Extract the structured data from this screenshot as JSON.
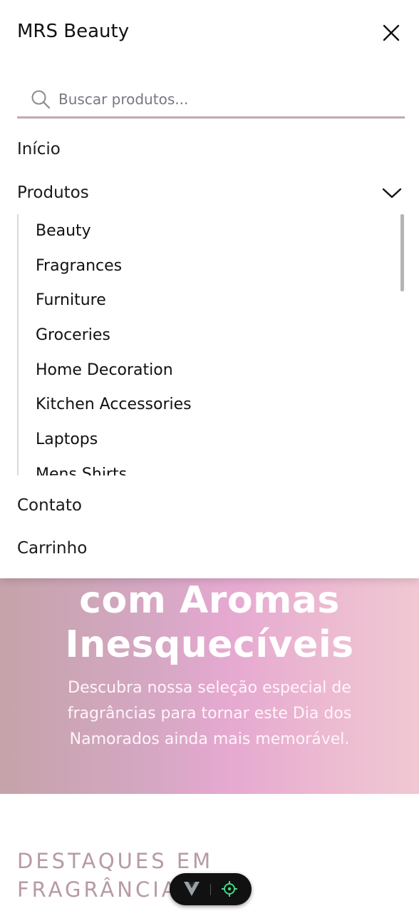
{
  "drawer": {
    "title": "MRS Beauty",
    "search": {
      "placeholder": "Buscar produtos..."
    },
    "nav": {
      "home": "Início",
      "products": "Produtos",
      "contact": "Contato",
      "cart": "Carrinho"
    },
    "categories": [
      "Beauty",
      "Fragrances",
      "Furniture",
      "Groceries",
      "Home Decoration",
      "Kitchen Accessories",
      "Laptops",
      "Mens Shirts"
    ]
  },
  "hero": {
    "title_line1": "com Aromas",
    "title_line2": "Inesquecíveis",
    "description": "Descubra nossa seleção especial de fragrâncias para tornar este Dia dos Namorados ainda mais memorável."
  },
  "featured": {
    "heading_line1": "DESTAQUES EM",
    "heading_line2": "FRAGRÂNCIAS"
  },
  "colors": {
    "accent_underline": "#c3a8ae",
    "heading_muted": "#b79aa5",
    "hero_gradient": [
      "#c5a3aa",
      "#e6a9d1",
      "#f0c8d2"
    ]
  },
  "icons": {
    "close": "close-icon",
    "search": "search-icon",
    "chevron": "chevron-down-icon",
    "devtool_logo": "vue-logo-icon",
    "devtool_target": "crosshair-icon"
  }
}
